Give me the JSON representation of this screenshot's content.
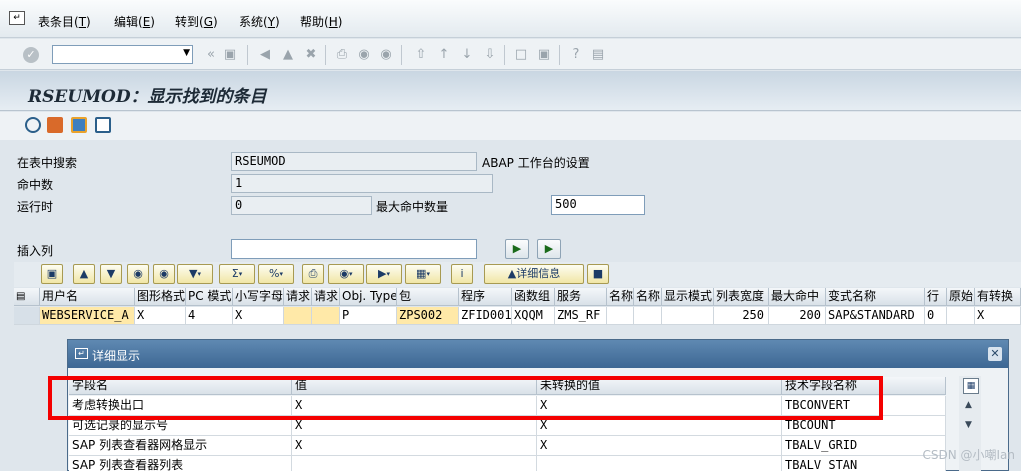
{
  "menu": {
    "items": [
      {
        "text": "表条目(",
        "key": "T",
        "close": ")"
      },
      {
        "text": "编辑(",
        "key": "E",
        "close": ")"
      },
      {
        "text": "转到(",
        "key": "G",
        "close": ")"
      },
      {
        "text": "系统(",
        "key": "Y",
        "close": ")"
      },
      {
        "text": "帮助(",
        "key": "H",
        "close": ")"
      }
    ]
  },
  "toolbar": {
    "command_value": "",
    "icons": [
      "enter-icon",
      "save-icon",
      "back-icon",
      "exit-icon",
      "cancel-icon",
      "print-icon",
      "find-icon",
      "find-next-icon",
      "first-page-icon",
      "prev-page-icon",
      "next-page-icon",
      "last-page-icon",
      "new-session-icon",
      "shortcut-icon",
      "help-icon",
      "layout-icon"
    ]
  },
  "page": {
    "title": "RSEUMOD：显示找到的条目"
  },
  "app_toolbar": {
    "icons": [
      "refresh-icon",
      "settings-icon",
      "check-icon",
      "list-icon"
    ]
  },
  "form": {
    "search_label": "在表中搜索",
    "search_value": "RSEUMOD",
    "search_desc": "ABAP 工作台的设置",
    "hits_label": "命中数",
    "hits_value": "1",
    "runtime_label": "运行时",
    "runtime_value": "0",
    "max_hits_label": "最大命中数量",
    "max_hits_value": "500",
    "insert_col_label": "插入列",
    "insert_col_value": ""
  },
  "alv_toolbar": {
    "detail_label": "详细信息"
  },
  "grid": {
    "headers": [
      "用户名",
      "图形格式",
      "PC 模式",
      "小写字母",
      "请求",
      "请求",
      "Obj. Type",
      "包",
      "程序",
      "函数组",
      "服务",
      "名称",
      "名称",
      "显示模式",
      "列表宽度",
      "最大命中",
      "变式名称",
      "行",
      "原始",
      "有转换"
    ],
    "row": [
      "WEBSERVICE_A",
      "X",
      "4",
      "X",
      "",
      "",
      "P",
      "ZPS002",
      "ZFID001",
      "XQQM",
      "ZMS_RF",
      "",
      "",
      "",
      "250",
      "200",
      "SAP&STANDARD",
      "0",
      "",
      "X"
    ]
  },
  "dialog": {
    "title": "详细显示",
    "headers": [
      "字段名",
      "值",
      "未转换的值",
      "技术字段名称"
    ],
    "rows": [
      [
        "考虑转换出口",
        "X",
        "X",
        "TBCONVERT"
      ],
      [
        "可选记录的显示号",
        "X",
        "X",
        "TBCOUNT"
      ],
      [
        "SAP 列表查看器网格显示",
        "X",
        "X",
        "TBALV_GRID"
      ],
      [
        "SAP 列表查看器列表",
        "",
        "",
        "TBALV_STAN"
      ]
    ]
  },
  "watermark": "CSDN @小嘲Ian"
}
